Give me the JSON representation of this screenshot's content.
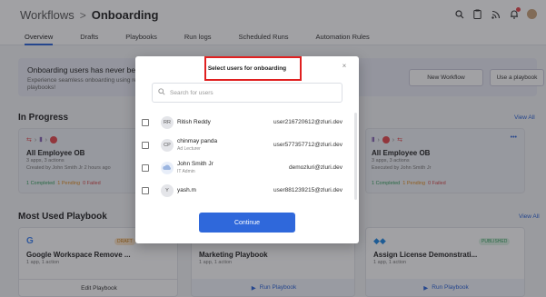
{
  "header": {
    "breadcrumb_first": "Workflows",
    "breadcrumb_sep": ">",
    "breadcrumb_current": "Onboarding"
  },
  "tabs": [
    {
      "label": "Overview",
      "active": true
    },
    {
      "label": "Drafts"
    },
    {
      "label": "Playbooks"
    },
    {
      "label": "Run logs"
    },
    {
      "label": "Scheduled Runs"
    },
    {
      "label": "Automation Rules"
    }
  ],
  "banner": {
    "title": "Onboarding users has never been th",
    "desc": "Experience seamless onboarding using re playbooks!",
    "new_workflow": "New Workflow",
    "use_playbook": "Use a playbook"
  },
  "in_progress": {
    "title": "In Progress",
    "view_all": "View All",
    "cards": [
      {
        "title": "All Employee OB",
        "sub": "3 apps, 3 actions",
        "meta": "Created by John Smith Jr 2 hours ago",
        "completed": "1 Completed",
        "pending": "1 Pending",
        "failed": "0 Failed"
      },
      {
        "title": "All Employee OB",
        "sub": "3 apps, 3 actions",
        "meta": "Executed by John Smith Jr",
        "completed": "1 Completed",
        "pending": "1 Pending",
        "failed": "0 Failed",
        "more": "•••"
      }
    ]
  },
  "most_used": {
    "title": "Most Used Playbook",
    "view_all": "View All",
    "cards": [
      {
        "title": "Google Workspace Remove ...",
        "sub": "1 app, 1 action",
        "badge": "DRAFT",
        "button": "Edit Playbook"
      },
      {
        "title": "Marketing Playbook",
        "sub": "1 app, 1 action",
        "button": "Run Playbook"
      },
      {
        "title": "Assign License Demonstrati...",
        "sub": "1 app, 1 action",
        "badge": "PUBLISHED",
        "button": "Run Playbook"
      }
    ]
  },
  "modal": {
    "title": "Select users for onboarding",
    "close": "×",
    "search_placeholder": "Search for users",
    "users": [
      {
        "initials": "RR",
        "name": "Ritish Reddy",
        "role": "",
        "email": "user216720612@zluri.dev"
      },
      {
        "initials": "CP",
        "name": "chinmay panda",
        "role": "Ad Lecturer",
        "email": "user577357712@zluri.dev"
      },
      {
        "initials": "",
        "name": "John Smith Jr",
        "role": "IT Admin",
        "email": "demozluri@zluri.dev"
      },
      {
        "initials": "Y",
        "name": "yash.m",
        "role": "",
        "email": "user881239215@zluri.dev"
      }
    ],
    "continue": "Continue"
  },
  "colors": {
    "accent": "#2f68db",
    "highlight": "#e02020"
  }
}
